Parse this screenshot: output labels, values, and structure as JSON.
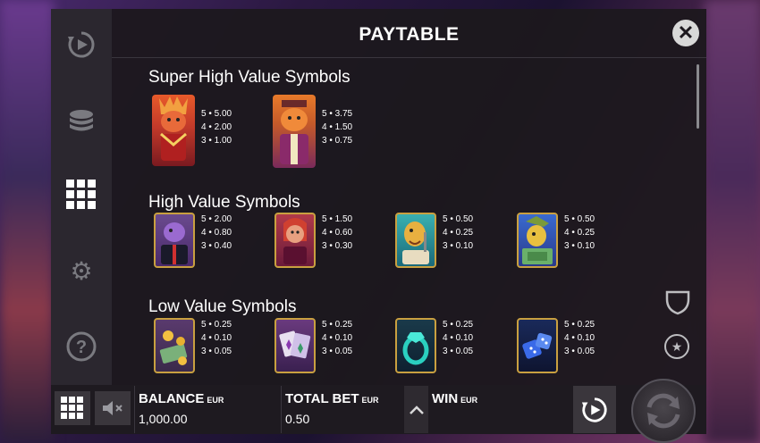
{
  "title": "PAYTABLE",
  "close_icon": "close-icon",
  "sidebar": {
    "items": [
      {
        "name": "autoplay-icon",
        "active": false
      },
      {
        "name": "coins-icon",
        "active": false
      },
      {
        "name": "grid-icon",
        "active": true
      },
      {
        "name": "gear-icon",
        "active": false
      },
      {
        "name": "help-icon",
        "active": false
      }
    ]
  },
  "sections": [
    {
      "title": "Super High Value Symbols",
      "symbols": [
        {
          "name": "dino-lady-red",
          "pays": [
            "5 • 5.00",
            "4 • 2.00",
            "3 • 1.00"
          ]
        },
        {
          "name": "dino-gent-orange",
          "pays": [
            "5 • 3.75",
            "4 • 1.50",
            "3 • 0.75"
          ]
        }
      ]
    },
    {
      "title": "High Value Symbols",
      "symbols": [
        {
          "name": "dino-mobster-purple",
          "pays": [
            "5 • 2.00",
            "4 • 0.80",
            "3 • 0.40"
          ]
        },
        {
          "name": "dino-diva-red",
          "pays": [
            "5 • 1.50",
            "4 • 0.60",
            "3 • 0.30"
          ]
        },
        {
          "name": "dino-singer-teal",
          "pays": [
            "5 • 0.50",
            "4 • 0.25",
            "3 • 0.10"
          ]
        },
        {
          "name": "dino-cash-blue",
          "pays": [
            "5 • 0.50",
            "4 • 0.25",
            "3 • 0.10"
          ]
        }
      ]
    },
    {
      "title": "Low Value Symbols",
      "symbols": [
        {
          "name": "money-gold",
          "pays": [
            "5 • 0.25",
            "4 • 0.10",
            "3 • 0.05"
          ]
        },
        {
          "name": "cards-purple",
          "pays": [
            "5 • 0.25",
            "4 • 0.10",
            "3 • 0.05"
          ]
        },
        {
          "name": "ring-teal",
          "pays": [
            "5 • 0.25",
            "4 • 0.10",
            "3 • 0.05"
          ]
        },
        {
          "name": "dice-blue",
          "pays": [
            "5 • 0.25",
            "4 • 0.10",
            "3 • 0.05"
          ]
        }
      ]
    }
  ],
  "bottom_bar": {
    "balance_label": "BALANCE",
    "balance_currency": "EUR",
    "balance_value": "1,000.00",
    "bet_label": "TOTAL BET",
    "bet_currency": "EUR",
    "bet_value": "0.50",
    "win_label": "WIN",
    "win_currency": "EUR",
    "win_value": ""
  },
  "colors": {
    "panel": "#1c181e",
    "sidebar": "#2c2830",
    "accent": "#ffffff"
  }
}
